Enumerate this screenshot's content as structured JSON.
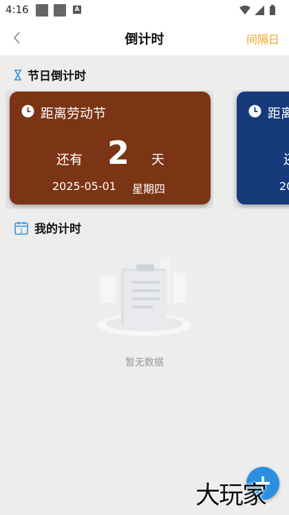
{
  "status_bar": {
    "time": "4:16"
  },
  "header": {
    "title": "倒计时",
    "right_link": "间隔日"
  },
  "holiday_section": {
    "title": "节日倒计时"
  },
  "cards": [
    {
      "name": "距离劳动节",
      "remain_label": "还有",
      "days": "2",
      "unit": "天",
      "date": "2025-05-01",
      "weekday": "星期四",
      "color": "#7b3515"
    },
    {
      "name": "距离",
      "remain_label": "还",
      "date_partial": "20",
      "color": "#163a7a"
    }
  ],
  "my_section": {
    "title": "我的计时",
    "empty_text": "暂无数据"
  },
  "fab": {
    "icon": "plus-icon",
    "label": "+"
  },
  "watermark": {
    "text": "大玩家"
  }
}
